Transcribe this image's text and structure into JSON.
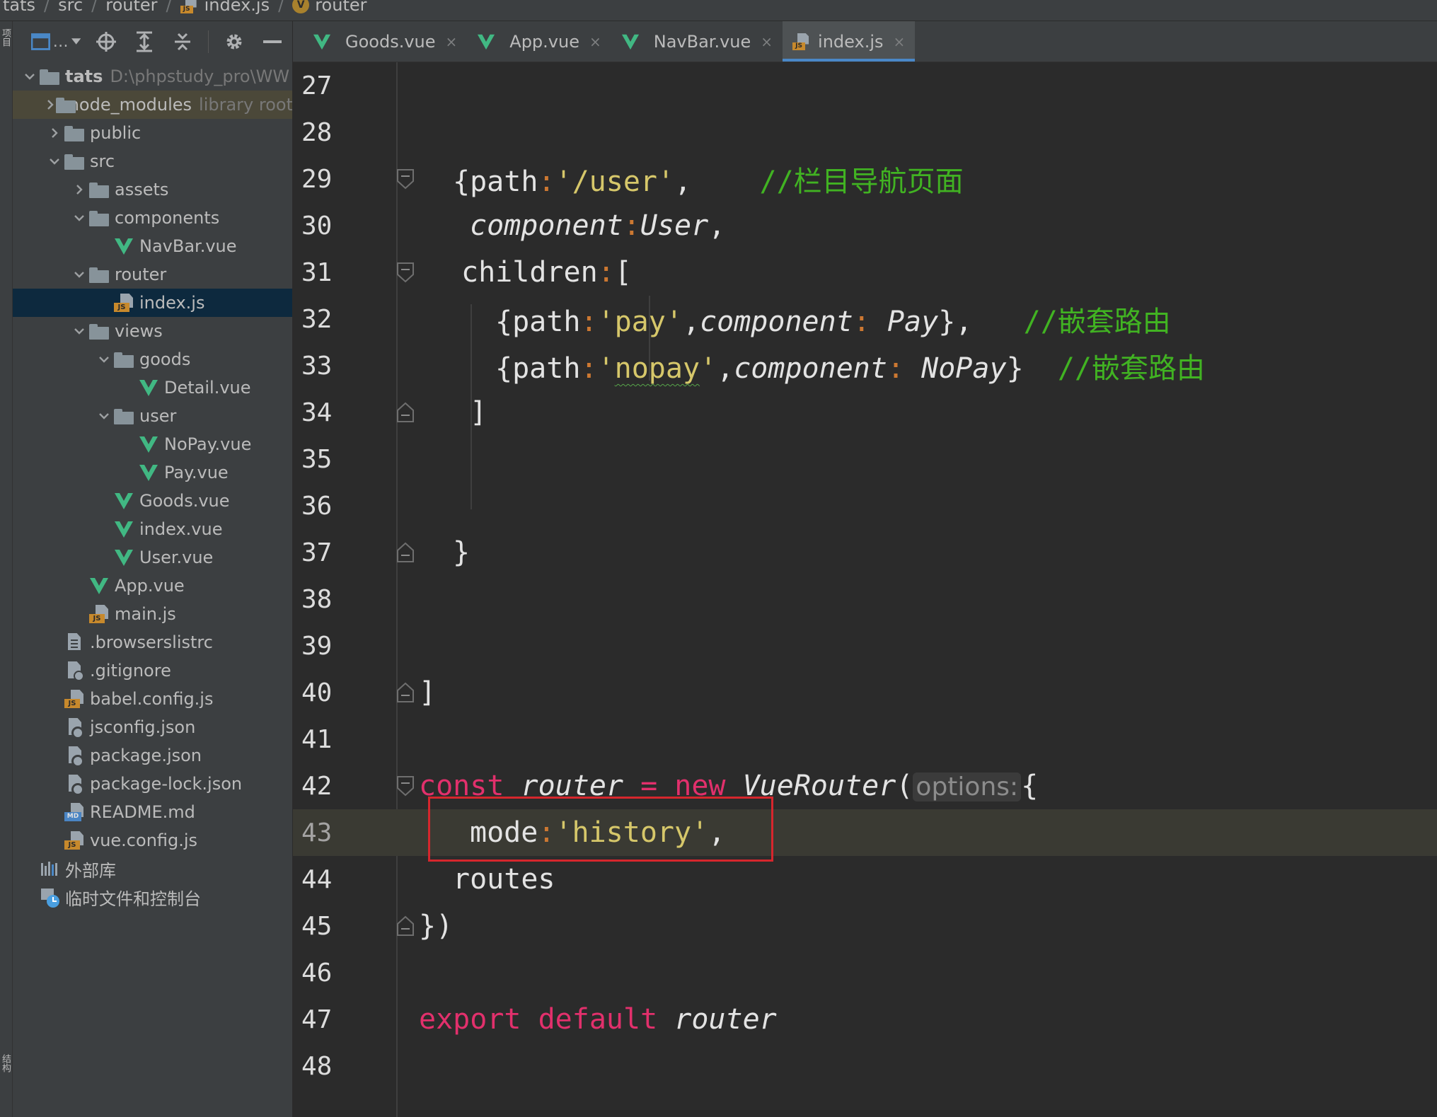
{
  "breadcrumb": {
    "items": [
      {
        "label": "tats",
        "icon": "none"
      },
      {
        "label": "src",
        "icon": "none"
      },
      {
        "label": "router",
        "icon": "none"
      },
      {
        "label": "index.js",
        "icon": "js-file-icon"
      },
      {
        "label": "router",
        "icon": "vue-component-icon"
      }
    ]
  },
  "stripe": {
    "top_label": "项目",
    "bottom_label": "结构"
  },
  "project_tree": [
    {
      "depth": 0,
      "arrow": "down",
      "icon": "folder-icon",
      "label": "tats",
      "hint": "D:\\phpstudy_pro\\WW",
      "bold": true
    },
    {
      "depth": 1,
      "arrow": "right",
      "icon": "folder-icon",
      "label": "node_modules",
      "hint": "library root",
      "state": "lib-highlight"
    },
    {
      "depth": 1,
      "arrow": "right",
      "icon": "folder-icon",
      "label": "public"
    },
    {
      "depth": 1,
      "arrow": "down",
      "icon": "folder-icon",
      "label": "src"
    },
    {
      "depth": 2,
      "arrow": "right",
      "icon": "folder-icon",
      "label": "assets"
    },
    {
      "depth": 2,
      "arrow": "down",
      "icon": "folder-icon",
      "label": "components"
    },
    {
      "depth": 3,
      "arrow": "none",
      "icon": "vue-icon",
      "label": "NavBar.vue"
    },
    {
      "depth": 2,
      "arrow": "down",
      "icon": "folder-icon",
      "label": "router"
    },
    {
      "depth": 3,
      "arrow": "none",
      "icon": "js-icon",
      "label": "index.js",
      "state": "selected"
    },
    {
      "depth": 2,
      "arrow": "down",
      "icon": "folder-icon",
      "label": "views"
    },
    {
      "depth": 3,
      "arrow": "down",
      "icon": "folder-icon",
      "label": "goods"
    },
    {
      "depth": 4,
      "arrow": "none",
      "icon": "vue-icon",
      "label": "Detail.vue"
    },
    {
      "depth": 3,
      "arrow": "down",
      "icon": "folder-icon",
      "label": "user"
    },
    {
      "depth": 4,
      "arrow": "none",
      "icon": "vue-icon",
      "label": "NoPay.vue"
    },
    {
      "depth": 4,
      "arrow": "none",
      "icon": "vue-icon",
      "label": "Pay.vue"
    },
    {
      "depth": 3,
      "arrow": "none",
      "icon": "vue-icon",
      "label": "Goods.vue"
    },
    {
      "depth": 3,
      "arrow": "none",
      "icon": "vue-icon",
      "label": "index.vue"
    },
    {
      "depth": 3,
      "arrow": "none",
      "icon": "vue-icon",
      "label": "User.vue"
    },
    {
      "depth": 2,
      "arrow": "none",
      "icon": "vue-icon",
      "label": "App.vue"
    },
    {
      "depth": 2,
      "arrow": "none",
      "icon": "js-icon",
      "label": "main.js"
    },
    {
      "depth": 1,
      "arrow": "none",
      "icon": "file-icon",
      "label": ".browserslistrc"
    },
    {
      "depth": 1,
      "arrow": "none",
      "icon": "git-icon",
      "label": ".gitignore"
    },
    {
      "depth": 1,
      "arrow": "none",
      "icon": "js-icon",
      "label": "babel.config.js"
    },
    {
      "depth": 1,
      "arrow": "none",
      "icon": "cfg-icon",
      "label": "jsconfig.json"
    },
    {
      "depth": 1,
      "arrow": "none",
      "icon": "cfg-icon",
      "label": "package.json"
    },
    {
      "depth": 1,
      "arrow": "none",
      "icon": "cfg-icon",
      "label": "package-lock.json"
    },
    {
      "depth": 1,
      "arrow": "none",
      "icon": "md-icon",
      "label": "README.md"
    },
    {
      "depth": 1,
      "arrow": "none",
      "icon": "js-icon",
      "label": "vue.config.js"
    },
    {
      "depth": 0,
      "arrow": "none",
      "icon": "lib-icon",
      "label": "外部库"
    },
    {
      "depth": 0,
      "arrow": "none",
      "icon": "scratch-icon",
      "label": "临时文件和控制台"
    }
  ],
  "tabs": [
    {
      "label": "Goods.vue",
      "icon": "vue-icon",
      "active": false
    },
    {
      "label": "App.vue",
      "icon": "vue-icon",
      "active": false
    },
    {
      "label": "NavBar.vue",
      "icon": "vue-icon",
      "active": false
    },
    {
      "label": "index.js",
      "icon": "js-icon",
      "active": true
    }
  ],
  "editor": {
    "current_line": 43,
    "lines": [
      {
        "n": "27",
        "indent": 0,
        "fold": null,
        "tokens": []
      },
      {
        "n": "28",
        "indent": 0,
        "fold": null,
        "tokens": []
      },
      {
        "n": "29",
        "indent": 1,
        "fold": "open",
        "tokens": [
          {
            "t": "{path",
            "c": "punct"
          },
          {
            "t": ":",
            "c": "colon"
          },
          {
            "t": "'/user'",
            "c": "str"
          },
          {
            "t": ",    ",
            "c": "punct"
          },
          {
            "t": "//栏目导航页面",
            "c": "comment"
          }
        ]
      },
      {
        "n": "30",
        "indent": 1.5,
        "fold": null,
        "tokens": [
          {
            "t": "component",
            "c": "ital"
          },
          {
            "t": ":",
            "c": "colon"
          },
          {
            "t": "User",
            "c": "ital"
          },
          {
            "t": ",",
            "c": "punct"
          }
        ]
      },
      {
        "n": "31",
        "indent": 1.25,
        "fold": "open",
        "tokens": [
          {
            "t": "children",
            "c": "punct"
          },
          {
            "t": ":",
            "c": "colon"
          },
          {
            "t": "[",
            "c": "punct"
          }
        ]
      },
      {
        "n": "32",
        "indent": 2.25,
        "fold": null,
        "tokens": [
          {
            "t": "{path",
            "c": "punct"
          },
          {
            "t": ":",
            "c": "colon"
          },
          {
            "t": "'pay'",
            "c": "str"
          },
          {
            "t": ",",
            "c": "punct"
          },
          {
            "t": "component",
            "c": "ital"
          },
          {
            "t": ": ",
            "c": "colon"
          },
          {
            "t": "Pay",
            "c": "ital"
          },
          {
            "t": "},   ",
            "c": "punct"
          },
          {
            "t": "//嵌套路由",
            "c": "comment"
          }
        ]
      },
      {
        "n": "33",
        "indent": 2.25,
        "fold": null,
        "tokens": [
          {
            "t": "{path",
            "c": "punct"
          },
          {
            "t": ":",
            "c": "colon"
          },
          {
            "t": "'",
            "c": "str"
          },
          {
            "t": "nopay",
            "c": "str-squiggle"
          },
          {
            "t": "'",
            "c": "str"
          },
          {
            "t": ",",
            "c": "punct"
          },
          {
            "t": "component",
            "c": "ital"
          },
          {
            "t": ": ",
            "c": "colon"
          },
          {
            "t": "NoPay",
            "c": "ital"
          },
          {
            "t": "}  ",
            "c": "punct"
          },
          {
            "t": "//嵌套路由",
            "c": "comment"
          }
        ]
      },
      {
        "n": "34",
        "indent": 1.5,
        "fold": "close",
        "tokens": [
          {
            "t": "]",
            "c": "punct"
          }
        ]
      },
      {
        "n": "35",
        "indent": 0,
        "fold": null,
        "tokens": []
      },
      {
        "n": "36",
        "indent": 0,
        "fold": null,
        "tokens": []
      },
      {
        "n": "37",
        "indent": 1,
        "fold": "close",
        "tokens": [
          {
            "t": "}",
            "c": "punct"
          }
        ]
      },
      {
        "n": "38",
        "indent": 0,
        "fold": null,
        "tokens": []
      },
      {
        "n": "39",
        "indent": 0,
        "fold": null,
        "tokens": []
      },
      {
        "n": "40",
        "indent": 0,
        "fold": "close",
        "tokens": [
          {
            "t": "]",
            "c": "punct"
          }
        ]
      },
      {
        "n": "41",
        "indent": 0,
        "fold": null,
        "tokens": []
      },
      {
        "n": "42",
        "indent": 0,
        "fold": "open",
        "tokens": [
          {
            "t": "const ",
            "c": "kw"
          },
          {
            "t": "router",
            "c": "ital"
          },
          {
            "t": " = ",
            "c": "kw"
          },
          {
            "t": "new ",
            "c": "kw"
          },
          {
            "t": "VueRouter",
            "c": "ital"
          },
          {
            "t": "(",
            "c": "punct"
          },
          {
            "t": "options:",
            "c": "hint"
          },
          {
            "t": "{",
            "c": "punct"
          }
        ]
      },
      {
        "n": "43",
        "indent": 1.5,
        "fold": null,
        "tokens": [
          {
            "t": "mode",
            "c": "punct"
          },
          {
            "t": ":",
            "c": "colon"
          },
          {
            "t": "'history'",
            "c": "str"
          },
          {
            "t": ",",
            "c": "punct"
          }
        ]
      },
      {
        "n": "44",
        "indent": 1,
        "fold": null,
        "tokens": [
          {
            "t": "routes",
            "c": "punct"
          }
        ]
      },
      {
        "n": "45",
        "indent": 0,
        "fold": "close",
        "tokens": [
          {
            "t": "})",
            "c": "punct"
          }
        ]
      },
      {
        "n": "46",
        "indent": 0,
        "fold": null,
        "tokens": []
      },
      {
        "n": "47",
        "indent": 0,
        "fold": null,
        "tokens": [
          {
            "t": "export ",
            "c": "kw"
          },
          {
            "t": "default ",
            "c": "kw"
          },
          {
            "t": "router",
            "c": "ital"
          }
        ]
      },
      {
        "n": "48",
        "indent": 0,
        "fold": null,
        "tokens": []
      }
    ]
  },
  "colors": {
    "keyword": "#e2306c",
    "string": "#d6c76a",
    "comment": "#41b322",
    "highlight_box": "#d6262d",
    "selection": "#0d293e",
    "vue_green": "#41b883"
  }
}
